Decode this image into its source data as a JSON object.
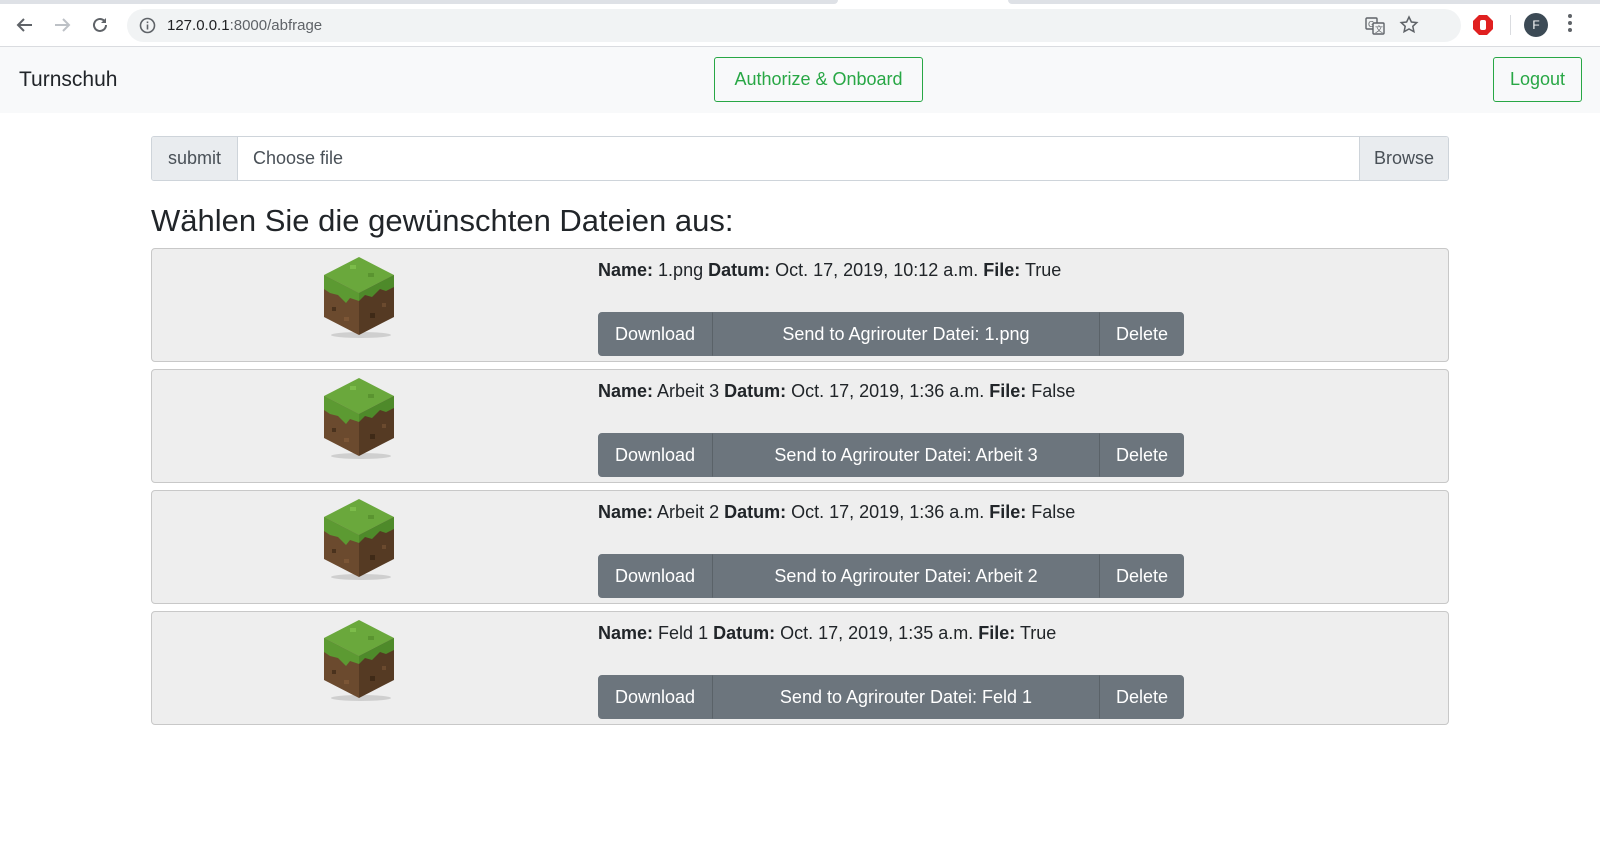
{
  "browser": {
    "url_host": "127.0.0.1",
    "url_path": ":8000/abfrage",
    "avatar_letter": "F"
  },
  "navbar": {
    "brand": "Turnschuh",
    "authorize_label": "Authorize & Onboard",
    "logout_label": "Logout",
    "accent_color": "#28a745"
  },
  "upload": {
    "submit_label": "submit",
    "choose_label": "Choose file",
    "browse_label": "Browse"
  },
  "heading": "Wählen Sie die gewünschten Dateien aus:",
  "labels": {
    "name": "Name:",
    "datum": "Datum:",
    "file": "File:",
    "download": "Download",
    "delete": "Delete"
  },
  "files": [
    {
      "name": "1.png",
      "datum": "Oct. 17, 2019, 10:12 a.m.",
      "file": "True",
      "send_label": "Send to Agrirouter Datei: 1.png"
    },
    {
      "name": "Arbeit 3",
      "datum": "Oct. 17, 2019, 1:36 a.m.",
      "file": "False",
      "send_label": "Send to Agrirouter Datei: Arbeit 3"
    },
    {
      "name": "Arbeit 2",
      "datum": "Oct. 17, 2019, 1:36 a.m.",
      "file": "False",
      "send_label": "Send to Agrirouter Datei: Arbeit 2"
    },
    {
      "name": "Feld 1",
      "datum": "Oct. 17, 2019, 1:35 a.m.",
      "file": "True",
      "send_label": "Send to Agrirouter Datei: Feld 1"
    }
  ]
}
